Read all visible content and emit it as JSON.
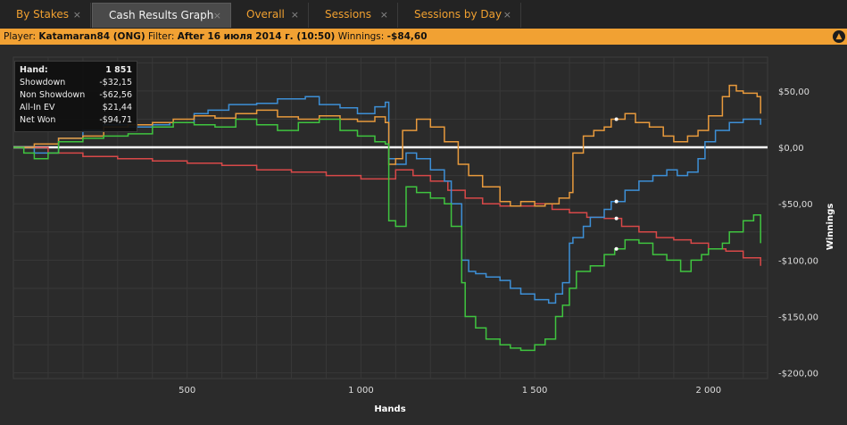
{
  "tabs": [
    {
      "label": "By Stakes",
      "active": false
    },
    {
      "label": "Cash Results Graph",
      "active": true
    },
    {
      "label": "Overall",
      "active": false
    },
    {
      "label": "Sessions",
      "active": false
    },
    {
      "label": "Sessions by Day",
      "active": false
    }
  ],
  "close_glyph": "×",
  "filter_bar": {
    "player_label": "Player:",
    "player": "Katamaran84 (ONG)",
    "filter_label": "Filter:",
    "filter": "After 16 июля 2014 г. (10:50)",
    "winnings_label": "Winnings:",
    "winnings": "-$84,60",
    "toggle_icon": "chevron-up-icon"
  },
  "stats": {
    "hand_label": "Hand:",
    "hand": "1 851",
    "showdown_label": "Showdown",
    "showdown": "-$32,15",
    "non_showdown_label": "Non Showdown",
    "non_showdown": "-$62,56",
    "allin_label": "All-In EV",
    "allin": "$21,44",
    "netwon_label": "Net Won",
    "netwon": "-$94,71"
  },
  "colors": {
    "background": "#2b2b2b",
    "tab_text": "#f0a030",
    "filter_bar": "#f1a133",
    "net_won": "#e89a3c",
    "all_in_ev": "#3d8fd6",
    "showdown": "#3fc43f",
    "non_showdown": "#d84848",
    "zero_line": "#ffffff"
  },
  "chart_data": {
    "type": "line",
    "xlabel": "Hands",
    "ylabel": "Winnings",
    "xlim": [
      0,
      2170
    ],
    "ylim": [
      -205,
      80
    ],
    "x_ticks": [
      {
        "value": 500,
        "label": "500"
      },
      {
        "value": 1000,
        "label": "1 000"
      },
      {
        "value": 1500,
        "label": "1 500"
      },
      {
        "value": 2000,
        "label": "2 000"
      }
    ],
    "y_ticks": [
      {
        "value": 50,
        "label": "$50,00"
      },
      {
        "value": 0,
        "label": "$0,00"
      },
      {
        "value": -50,
        "label": "-$50,00"
      },
      {
        "value": -100,
        "label": "-$100,00"
      },
      {
        "value": -150,
        "label": "-$150,00"
      },
      {
        "value": -200,
        "label": "-$200,00"
      }
    ],
    "grid": true,
    "cursor_hand": 1735,
    "series": [
      {
        "key": "all_in_ev",
        "x": [
          0,
          60,
          130,
          200,
          260,
          330,
          400,
          450,
          520,
          560,
          620,
          700,
          760,
          840,
          880,
          940,
          990,
          1040,
          1070,
          1080,
          1100,
          1130,
          1160,
          1200,
          1240,
          1260,
          1290,
          1310,
          1330,
          1360,
          1400,
          1430,
          1460,
          1500,
          1540,
          1560,
          1580,
          1600,
          1610,
          1640,
          1660,
          1700,
          1720,
          1760,
          1800,
          1840,
          1880,
          1910,
          1940,
          1970,
          1990,
          2020,
          2060,
          2100,
          2150
        ],
        "values": [
          0,
          -5,
          8,
          15,
          20,
          18,
          20,
          22,
          30,
          33,
          38,
          39,
          43,
          45,
          38,
          35,
          30,
          36,
          40,
          -10,
          -15,
          -5,
          -10,
          -20,
          -30,
          -50,
          -100,
          -110,
          -112,
          -115,
          -118,
          -125,
          -130,
          -135,
          -138,
          -130,
          -120,
          -85,
          -80,
          -70,
          -62,
          -55,
          -48,
          -38,
          -30,
          -25,
          -20,
          -25,
          -22,
          -10,
          5,
          15,
          22,
          25,
          20
        ]
      },
      {
        "key": "net_won",
        "x": [
          0,
          60,
          130,
          200,
          260,
          330,
          400,
          460,
          520,
          580,
          640,
          700,
          760,
          820,
          880,
          940,
          990,
          1040,
          1070,
          1080,
          1100,
          1120,
          1160,
          1200,
          1240,
          1280,
          1310,
          1350,
          1400,
          1430,
          1460,
          1500,
          1530,
          1570,
          1600,
          1610,
          1640,
          1670,
          1700,
          1720,
          1760,
          1790,
          1830,
          1870,
          1900,
          1940,
          1970,
          2000,
          2040,
          2060,
          2080,
          2100,
          2140,
          2150
        ],
        "values": [
          0,
          3,
          8,
          10,
          18,
          20,
          22,
          25,
          28,
          26,
          30,
          33,
          27,
          25,
          28,
          25,
          23,
          27,
          22,
          -15,
          -10,
          15,
          25,
          18,
          5,
          -15,
          -25,
          -35,
          -48,
          -52,
          -48,
          -52,
          -50,
          -45,
          -40,
          -5,
          10,
          15,
          18,
          25,
          30,
          22,
          18,
          10,
          5,
          10,
          15,
          28,
          45,
          55,
          50,
          48,
          45,
          30
        ]
      },
      {
        "key": "showdown",
        "x": [
          0,
          30,
          60,
          100,
          130,
          200,
          260,
          330,
          400,
          460,
          520,
          580,
          640,
          700,
          760,
          820,
          880,
          940,
          990,
          1040,
          1070,
          1080,
          1100,
          1130,
          1160,
          1200,
          1240,
          1260,
          1290,
          1300,
          1330,
          1360,
          1400,
          1430,
          1460,
          1500,
          1530,
          1560,
          1580,
          1600,
          1620,
          1640,
          1660,
          1700,
          1730,
          1760,
          1800,
          1840,
          1880,
          1920,
          1950,
          1980,
          2000,
          2040,
          2060,
          2100,
          2130,
          2150
        ],
        "values": [
          0,
          -5,
          -10,
          -5,
          5,
          8,
          10,
          12,
          18,
          22,
          20,
          18,
          25,
          20,
          15,
          22,
          25,
          15,
          10,
          5,
          3,
          -65,
          -70,
          -35,
          -40,
          -45,
          -50,
          -70,
          -120,
          -150,
          -160,
          -170,
          -175,
          -178,
          -180,
          -175,
          -170,
          -150,
          -140,
          -125,
          -110,
          -110,
          -105,
          -95,
          -90,
          -82,
          -85,
          -95,
          -100,
          -110,
          -100,
          -95,
          -90,
          -85,
          -75,
          -65,
          -60,
          -85
        ]
      },
      {
        "key": "non_showdown",
        "x": [
          0,
          100,
          200,
          300,
          400,
          500,
          600,
          700,
          800,
          900,
          1000,
          1080,
          1100,
          1150,
          1200,
          1250,
          1300,
          1350,
          1400,
          1450,
          1500,
          1550,
          1600,
          1650,
          1700,
          1750,
          1800,
          1850,
          1900,
          1950,
          2000,
          2050,
          2100,
          2150
        ],
        "values": [
          0,
          -5,
          -8,
          -10,
          -12,
          -14,
          -16,
          -20,
          -22,
          -25,
          -28,
          -28,
          -20,
          -25,
          -30,
          -38,
          -45,
          -50,
          -52,
          -52,
          -50,
          -55,
          -58,
          -62,
          -63,
          -70,
          -75,
          -80,
          -82,
          -85,
          -90,
          -92,
          -98,
          -105
        ]
      }
    ]
  }
}
